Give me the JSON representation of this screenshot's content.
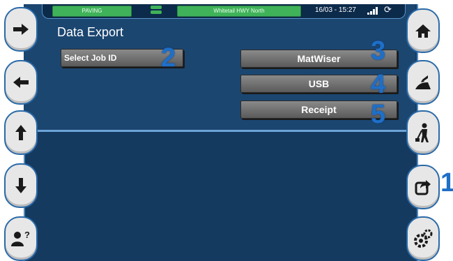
{
  "statusbar": {
    "mode": "PAVING",
    "job": "Whitetail HWY North",
    "datetime": "16/03 - 15:27"
  },
  "page": {
    "title": "Data Export"
  },
  "buttons": {
    "select_job": "Select Job ID",
    "matwiser": "MatWiser",
    "usb": "USB",
    "receipt": "Receipt"
  },
  "callouts": {
    "c1": "1",
    "c2": "2",
    "c3": "3",
    "c4": "4",
    "c5": "5"
  },
  "left_nav": [
    {
      "icon": "arrow-right-icon"
    },
    {
      "icon": "arrow-left-icon"
    },
    {
      "icon": "arrow-up-icon"
    },
    {
      "icon": "arrow-down-icon"
    },
    {
      "icon": "user-help-icon"
    }
  ],
  "right_nav": [
    {
      "icon": "home-icon"
    },
    {
      "icon": "paving-icon"
    },
    {
      "icon": "worker-icon"
    },
    {
      "icon": "export-icon"
    },
    {
      "icon": "settings-icon"
    }
  ],
  "colors": {
    "panel": "#153a60",
    "status_green": "#3fb25a",
    "callout_blue": "#1e6fc8"
  }
}
